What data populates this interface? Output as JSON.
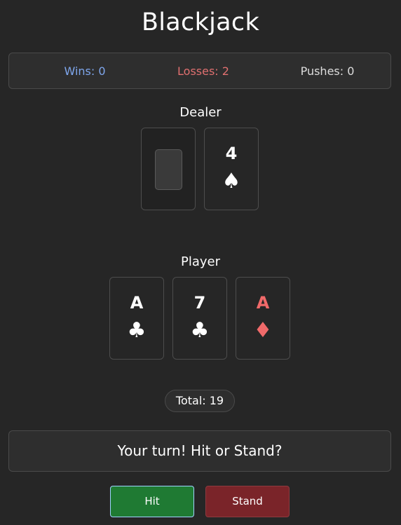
{
  "title": "Blackjack",
  "scoreboard": {
    "wins": "Wins: 0",
    "losses": "Losses: 2",
    "pushes": "Pushes: 0"
  },
  "dealer": {
    "label": "Dealer",
    "cards": [
      {
        "face_down": true
      },
      {
        "rank": "4",
        "suit": "♠",
        "suit_name": "spades",
        "color": "#ffffff"
      }
    ]
  },
  "player": {
    "label": "Player",
    "cards": [
      {
        "rank": "A",
        "suit": "♣",
        "suit_name": "clubs",
        "color": "#ffffff"
      },
      {
        "rank": "7",
        "suit": "♣",
        "suit_name": "clubs",
        "color": "#ffffff"
      },
      {
        "rank": "A",
        "suit": "♦",
        "suit_name": "diamonds",
        "color": "#f06a6a"
      }
    ],
    "total": "Total: 19"
  },
  "message": "Your turn! Hit or Stand?",
  "buttons": {
    "hit": "Hit",
    "stand": "Stand"
  },
  "colors": {
    "background": "#262626",
    "wins": "#7ea6ec",
    "losses": "#e07070",
    "hit_button": "#1f7a33",
    "stand_button": "#7a2429"
  }
}
